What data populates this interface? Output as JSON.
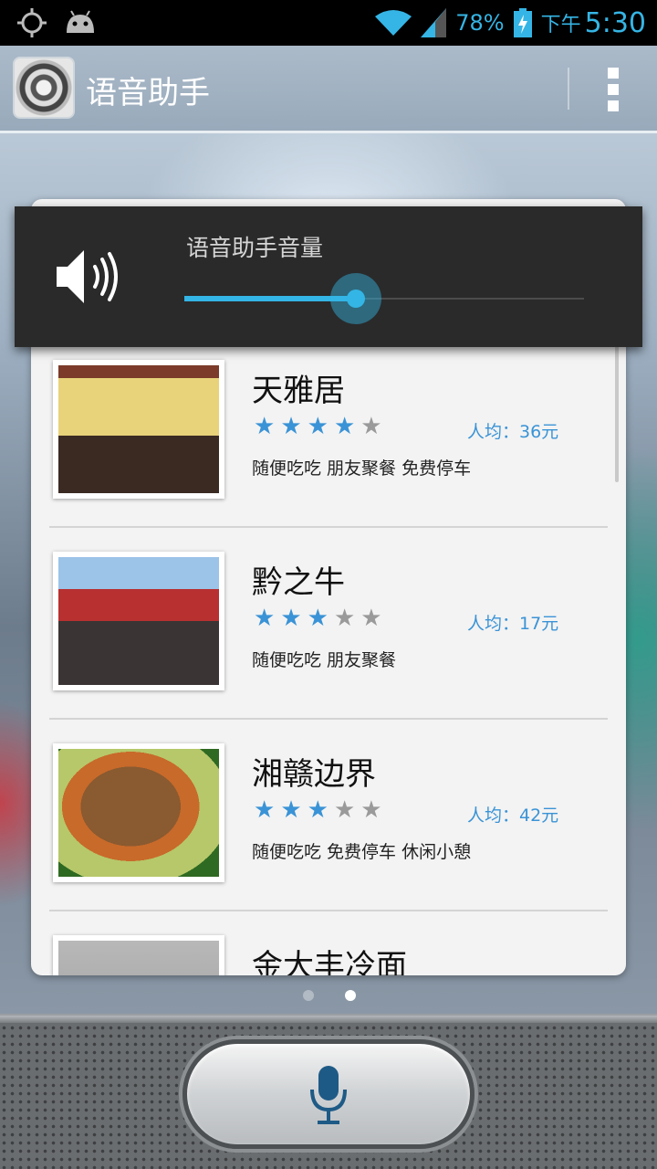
{
  "status_bar": {
    "battery_pct": "78%",
    "time_prefix": "下午",
    "time": "5:30",
    "accent_color": "#35b5e5",
    "icons": [
      "gps-icon",
      "android-icon",
      "wifi-icon",
      "signal-icon",
      "battery-charging-icon"
    ]
  },
  "action_bar": {
    "title": "语音助手",
    "icons": [
      "app-logo-icon",
      "overflow-menu-icon"
    ]
  },
  "volume_panel": {
    "label": "语音助手音量",
    "level": 0.43,
    "accent_color": "#33b5e5",
    "icon": "speaker-volume-icon"
  },
  "results": [
    {
      "name": "天雅居",
      "rating": 4,
      "max_rating": 5,
      "price": "人均：36元",
      "tags": "随便吃吃 朋友聚餐 免费停车"
    },
    {
      "name": "黔之牛",
      "rating": 3,
      "max_rating": 5,
      "price": "人均：17元",
      "tags": "随便吃吃 朋友聚餐"
    },
    {
      "name": "湘赣边界",
      "rating": 3,
      "max_rating": 5,
      "price": "人均：42元",
      "tags": "随便吃吃 免费停车 休闲小憩"
    },
    {
      "name": "金大丰冷面",
      "rating": null,
      "max_rating": 5,
      "price": "",
      "tags": ""
    }
  ],
  "pager": {
    "pages": 2,
    "current": 2
  },
  "bottom": {
    "mic_icon": "microphone-icon"
  }
}
